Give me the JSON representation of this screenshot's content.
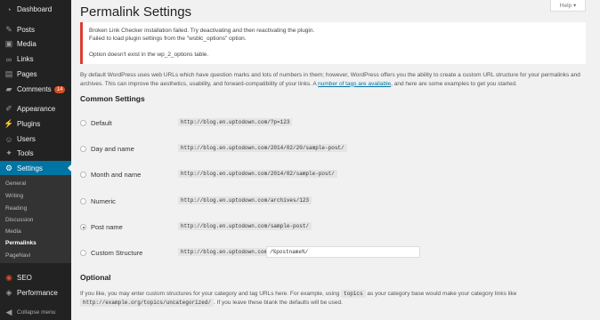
{
  "sidebar": {
    "items": [
      {
        "label": "Dashboard",
        "icon": "dashboard-icon",
        "glyph": "◔"
      },
      {
        "label": "Posts",
        "icon": "pin-icon",
        "glyph": "✎"
      },
      {
        "label": "Media",
        "icon": "media-icon",
        "glyph": "▣"
      },
      {
        "label": "Links",
        "icon": "link-icon",
        "glyph": "∞"
      },
      {
        "label": "Pages",
        "icon": "page-icon",
        "glyph": "▤"
      },
      {
        "label": "Comments",
        "icon": "comment-icon",
        "glyph": "▰",
        "badge": "14"
      },
      {
        "label": "Appearance",
        "icon": "brush-icon",
        "glyph": "✐"
      },
      {
        "label": "Plugins",
        "icon": "plug-icon",
        "glyph": "⚡"
      },
      {
        "label": "Users",
        "icon": "users-icon",
        "glyph": "☺"
      },
      {
        "label": "Tools",
        "icon": "wrench-icon",
        "glyph": "✦"
      },
      {
        "label": "Settings",
        "icon": "settings-icon",
        "glyph": "⚙"
      },
      {
        "label": "SEO",
        "icon": "seo-icon",
        "glyph": "◉"
      },
      {
        "label": "Performance",
        "icon": "performance-icon",
        "glyph": "◈"
      },
      {
        "label": "Collapse menu",
        "icon": "collapse-icon",
        "glyph": "◀"
      }
    ],
    "submenu": [
      "General",
      "Writing",
      "Reading",
      "Discussion",
      "Media",
      "Permalinks",
      "PageNavi"
    ]
  },
  "header": {
    "help": "Help ▾",
    "title": "Permalink Settings"
  },
  "notice": {
    "line1": "Broken Link Checker installation failed. Try deactivating and then reactivating the plugin.",
    "line2": "Failed to load plugin settings from the \"wsblc_options\" option.",
    "line3": "Option doesn't exist in the wp_2_options table."
  },
  "intro": {
    "before": "By default WordPress uses web URLs which have question marks and lots of numbers in them; however, WordPress offers you the ability to create a custom URL structure for your permalinks and archives. This can improve the aesthetics, usability, and forward-compatibility of your links. A ",
    "link": "number of tags are available",
    "after": ", and here are some examples to get you started."
  },
  "common_settings": {
    "heading": "Common Settings",
    "options": [
      {
        "label": "Default",
        "code": "http://blog.en.uptodown.com/?p=123",
        "checked": false
      },
      {
        "label": "Day and name",
        "code": "http://blog.en.uptodown.com/2014/02/20/sample-post/",
        "checked": false
      },
      {
        "label": "Month and name",
        "code": "http://blog.en.uptodown.com/2014/02/sample-post/",
        "checked": false
      },
      {
        "label": "Numeric",
        "code": "http://blog.en.uptodown.com/archives/123",
        "checked": false
      },
      {
        "label": "Post name",
        "code": "http://blog.en.uptodown.com/sample-post/",
        "checked": true
      },
      {
        "label": "Custom Structure",
        "code": "http://blog.en.uptodown.com",
        "checked": false
      }
    ],
    "custom_value": "/%postname%/"
  },
  "optional": {
    "heading": "Optional",
    "text1": "If you like, you may enter custom structures for your category and tag URLs here. For example, using ",
    "code1": "topics",
    "text2": " as your category base would make your category links like",
    "code2": "http://example.org/topics/uncategorized/",
    "text3": ". If you leave these blank the defaults will be used."
  }
}
